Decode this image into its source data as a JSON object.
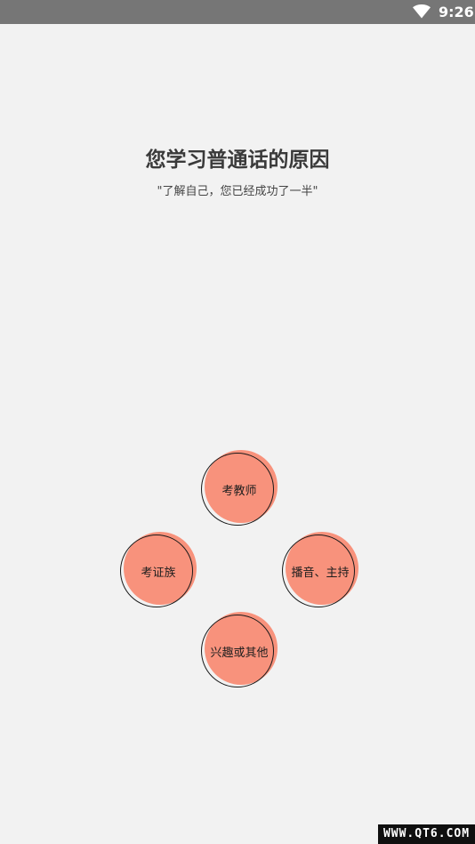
{
  "status_bar": {
    "time": "9:26",
    "wifi_icon": "wifi-icon"
  },
  "header": {
    "title": "您学习普通话的原因",
    "subtitle": "\"了解自己，您已经成功了一半\""
  },
  "choices": [
    {
      "label": "考教师"
    },
    {
      "label": "考证族"
    },
    {
      "label": "播音、主持"
    },
    {
      "label": "兴趣或其他"
    }
  ],
  "colors": {
    "choice_fill": "#f8927c",
    "choice_ring": "#1a1a1a",
    "background": "#f2f2f2",
    "status_bar": "#767676"
  },
  "watermark": "WWW.QT6.COM"
}
